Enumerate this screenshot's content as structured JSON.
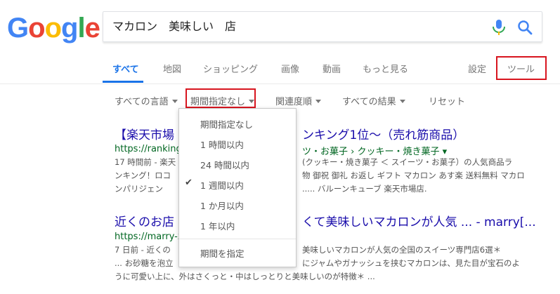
{
  "logo": {
    "letters": [
      "G",
      "o",
      "o",
      "g",
      "l",
      "e"
    ],
    "colors": [
      "#4285f4",
      "#ea4335",
      "#fbbc05",
      "#4285f4",
      "#34a853",
      "#ea4335"
    ]
  },
  "search": {
    "query": "マカロン　美味しい　店"
  },
  "tabs": [
    {
      "label": "すべて",
      "active": true
    },
    {
      "label": "地図"
    },
    {
      "label": "ショッピング"
    },
    {
      "label": "画像"
    },
    {
      "label": "動画"
    },
    {
      "label": "もっと見る"
    }
  ],
  "settings_label": "設定",
  "tools_label": "ツール",
  "filters": {
    "language": "すべての言語",
    "period": "期間指定なし",
    "sort": "関連度順",
    "results": "すべての結果",
    "reset": "リセット"
  },
  "dropdown": {
    "items": [
      "期間指定なし",
      "1 時間以内",
      "24 時間以内",
      "1 週間以内",
      "1 か月以内",
      "1 年以内"
    ],
    "checked_index": 3,
    "custom": "期間を指定"
  },
  "results": [
    {
      "title_left": "【楽天市場",
      "title_right": "ンキング1位～（売れ筋商品）",
      "url_left": "https://ranking.",
      "url_right": "ツ・お菓子 › クッキー・焼き菓子 ▾",
      "snippet_lines": [
        {
          "left": "17 時間前 - 楽天",
          "right": "(クッキー・焼き菓子 ＜ スイーツ・お菓子）の人気商品ラ"
        },
        {
          "left": "ンキング！ロコ",
          "right": "物 御祝 御礼 お返し ギフト マカロン あす楽 送料無料 マカロ"
        },
        {
          "left": "ンパリジェン",
          "right": "..... バルーンキューブ 楽天市場店."
        }
      ]
    },
    {
      "title_left": "近くのお店",
      "title_right": "くて美味しいマカロンが人気 ... - marry[...",
      "url_left": "https://marry-x",
      "url_right": "",
      "snippet_lines": [
        {
          "left": "7 日前 - 近くの",
          "right": "美味しいマカロンが人気の全国のスイーツ専門店6選＊"
        },
        {
          "left": "... お砂糖を泡立",
          "right": "にジャムやガナッシュを挟むマカロンは、見た目が宝石のよ"
        },
        {
          "left": "うに可愛い上に、外はさくっと・中はしっとりと美味しいのが特徴＊ ...",
          "right": ""
        }
      ]
    }
  ]
}
